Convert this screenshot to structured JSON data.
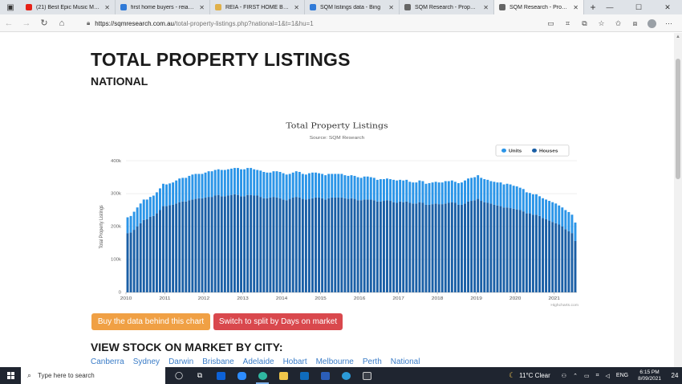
{
  "browser": {
    "tabs": [
      {
        "title": "(21) Best Epic Music Mix 20",
        "favicon_color": "#e62117",
        "active": false
      },
      {
        "title": "first home buyers - reia - Bi",
        "favicon_color": "#2f7ad8",
        "active": false
      },
      {
        "title": "REIA - FIRST HOME BUYERS",
        "favicon_color": "#e0b04a",
        "active": false
      },
      {
        "title": "SQM listings data - Bing",
        "favicon_color": "#2f7ad8",
        "active": false
      },
      {
        "title": "SQM Research - Property -",
        "favicon_color": "#666666",
        "active": false
      },
      {
        "title": "SQM Research - Property -",
        "favicon_color": "#666666",
        "active": true
      }
    ],
    "new_tab": "+",
    "url_host": "https://sqmresearch.com.au",
    "url_path": "/total-property-listings.php?national=1&t=1&hu=1"
  },
  "page": {
    "title": "TOTAL PROPERTY LISTINGS",
    "subtitle": "NATIONAL",
    "buy_button": "Buy the data behind this chart",
    "split_button": "Switch to split by Days on market",
    "city_heading": "VIEW STOCK ON MARKET BY CITY:",
    "cities": [
      "Canberra",
      "Sydney",
      "Darwin",
      "Brisbane",
      "Adelaide",
      "Hobart",
      "Melbourne",
      "Perth",
      "National"
    ]
  },
  "chart_data": {
    "type": "bar",
    "stacked": true,
    "title": "Total Property Listings",
    "subtitle": "Source: SQM Research",
    "ylabel": "Total Property Listings",
    "xlabel": "",
    "ylim": [
      0,
      400000
    ],
    "y_ticks": [
      "0",
      "100k",
      "200k",
      "300k",
      "400k"
    ],
    "x_ticks": [
      "2010",
      "2011",
      "2012",
      "2013",
      "2014",
      "2015",
      "2016",
      "2017",
      "2018",
      "2019",
      "2020",
      "2021"
    ],
    "credit": "Highcharts.com",
    "grid": true,
    "legend_position": "top-right",
    "series": [
      {
        "name": "Units",
        "color": "#2b95e8",
        "values": [
          48000,
          50000,
          55000,
          58000,
          60000,
          62000,
          60000,
          60000,
          62000,
          64000,
          66000,
          68000,
          66000,
          66000,
          68000,
          70000,
          72000,
          72000,
          72000,
          74000,
          76000,
          76000,
          74000,
          74000,
          76000,
          78000,
          78000,
          78000,
          78000,
          80000,
          80000,
          80000,
          80000,
          80000,
          82000,
          82000,
          82000,
          82000,
          82000,
          80000,
          78000,
          80000,
          80000,
          78000,
          76000,
          78000,
          80000,
          80000,
          80000,
          78000,
          76000,
          76000,
          78000,
          78000,
          76000,
          76000,
          78000,
          78000,
          76000,
          74000,
          74000,
          74000,
          74000,
          72000,
          72000,
          72000,
          72000,
          70000,
          70000,
          70000,
          70000,
          70000,
          68000,
          70000,
          70000,
          68000,
          68000,
          66000,
          68000,
          66000,
          66000,
          66000,
          68000,
          68000,
          66000,
          66000,
          66000,
          64000,
          64000,
          64000,
          66000,
          66000,
          64000,
          66000,
          66000,
          66000,
          66000,
          66000,
          68000,
          66000,
          66000,
          64000,
          66000,
          68000,
          70000,
          70000,
          70000,
          70000,
          72000,
          70000,
          70000,
          70000,
          68000,
          70000,
          70000,
          72000,
          70000,
          72000,
          72000,
          70000,
          70000,
          68000,
          68000,
          64000,
          62000,
          62000,
          62000,
          60000,
          60000,
          60000,
          60000,
          60000,
          60000,
          58000,
          58000,
          58000,
          58000,
          56000,
          56000
        ]
      },
      {
        "name": "Houses",
        "color": "#1a5fa6",
        "values": [
          180000,
          182000,
          190000,
          200000,
          210000,
          220000,
          222000,
          230000,
          232000,
          240000,
          250000,
          262000,
          262000,
          265000,
          266000,
          270000,
          274000,
          276000,
          276000,
          280000,
          282000,
          284000,
          286000,
          286000,
          288000,
          290000,
          290000,
          294000,
          296000,
          292000,
          292000,
          294000,
          296000,
          298000,
          296000,
          292000,
          292000,
          296000,
          296000,
          294000,
          294000,
          290000,
          286000,
          286000,
          288000,
          290000,
          288000,
          286000,
          282000,
          280000,
          284000,
          288000,
          290000,
          288000,
          284000,
          282000,
          284000,
          286000,
          288000,
          288000,
          286000,
          282000,
          286000,
          288000,
          288000,
          288000,
          288000,
          286000,
          284000,
          286000,
          284000,
          280000,
          280000,
          282000,
          282000,
          282000,
          280000,
          276000,
          276000,
          278000,
          280000,
          278000,
          274000,
          272000,
          276000,
          274000,
          276000,
          272000,
          270000,
          270000,
          274000,
          272000,
          266000,
          266000,
          268000,
          270000,
          268000,
          268000,
          270000,
          272000,
          274000,
          272000,
          266000,
          266000,
          270000,
          276000,
          278000,
          280000,
          284000,
          278000,
          274000,
          272000,
          270000,
          266000,
          264000,
          262000,
          258000,
          258000,
          256000,
          254000,
          252000,
          250000,
          246000,
          240000,
          240000,
          236000,
          236000,
          232000,
          226000,
          222000,
          218000,
          214000,
          210000,
          206000,
          200000,
          192000,
          186000,
          180000,
          156000
        ]
      }
    ]
  },
  "taskbar": {
    "search_placeholder": "Type here to search",
    "weather": "11°C  Clear",
    "lang": "ENG",
    "time": "6:15 PM",
    "date": "8/09/2021",
    "notifications": "24"
  }
}
